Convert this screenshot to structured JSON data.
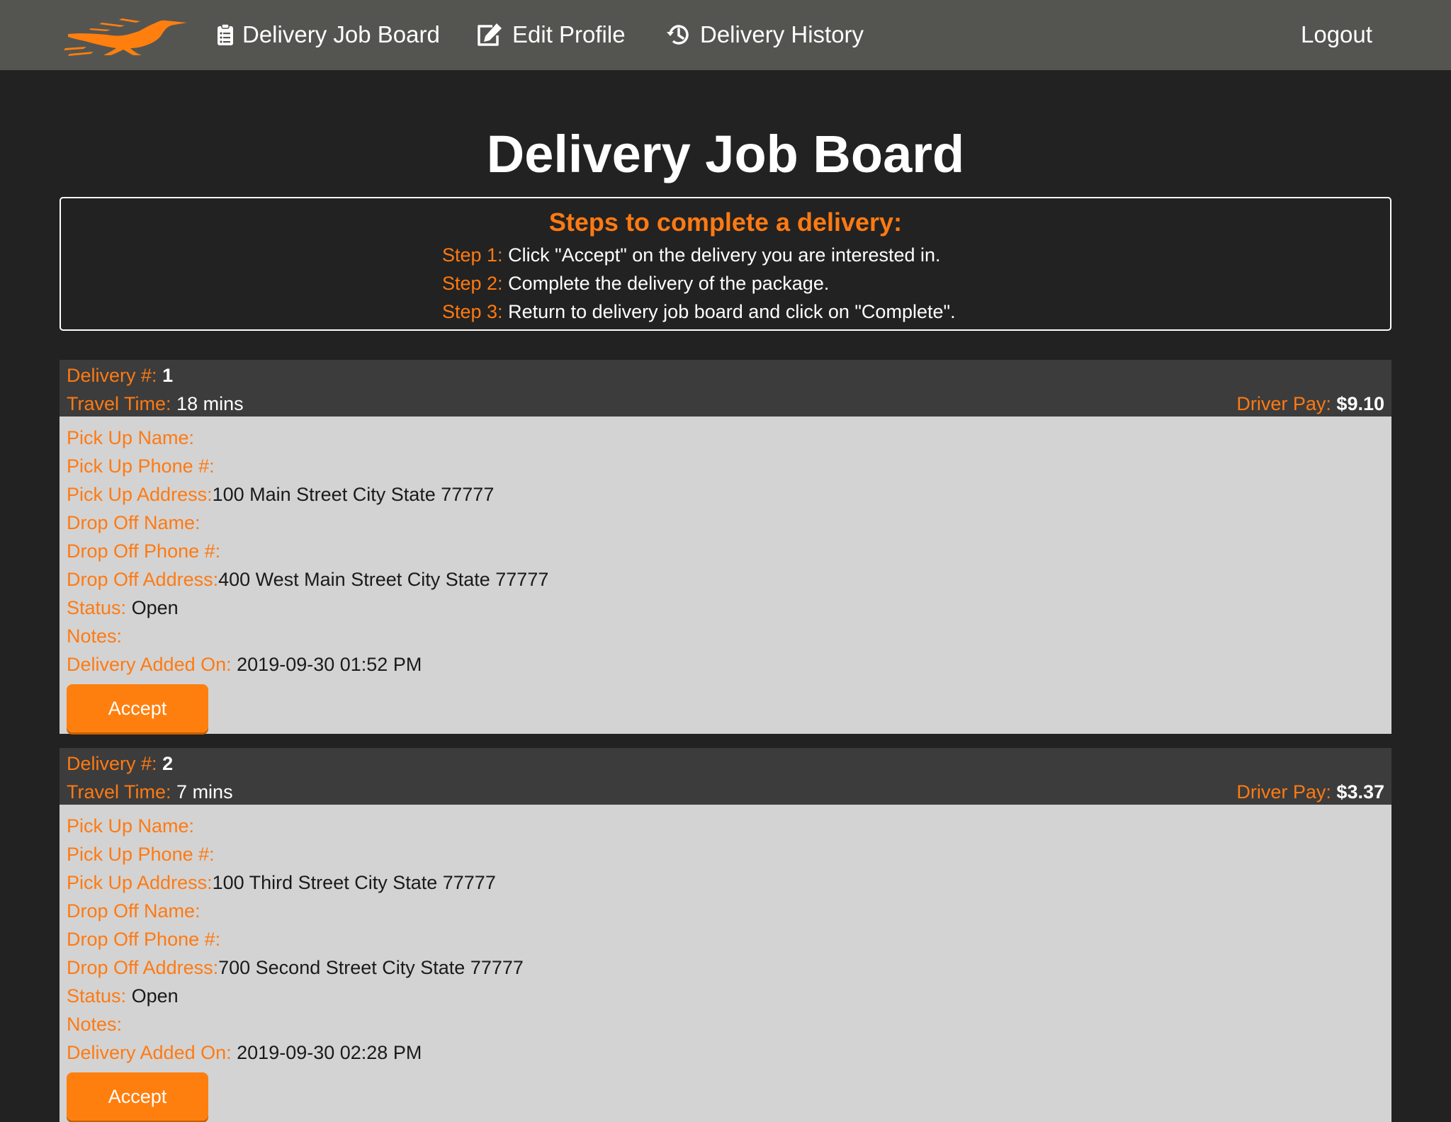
{
  "nav": {
    "job_board_label": "Delivery Job Board",
    "edit_profile_label": "Edit Profile",
    "history_label": "Delivery History",
    "logout_label": "Logout"
  },
  "page_title": "Delivery Job Board",
  "steps": {
    "heading": "Steps to complete a delivery:",
    "items": [
      {
        "label": "Step 1:",
        "text": "Click \"Accept\" on the delivery you are interested in."
      },
      {
        "label": "Step 2:",
        "text": "Complete the delivery of the package."
      },
      {
        "label": "Step 3:",
        "text": "Return to delivery job board and click on \"Complete\"."
      }
    ]
  },
  "labels": {
    "delivery_num": "Delivery #:",
    "travel_time": "Travel Time:",
    "driver_pay": "Driver Pay:",
    "pickup_name": "Pick Up Name:",
    "pickup_phone": "Pick Up Phone #:",
    "pickup_address": "Pick Up Address:",
    "dropoff_name": "Drop Off Name:",
    "dropoff_phone": "Drop Off Phone #:",
    "dropoff_address": "Drop Off Address:",
    "status": "Status:",
    "notes": "Notes:",
    "added_on": "Delivery Added On:",
    "accept": "Accept"
  },
  "deliveries": [
    {
      "number": "1",
      "travel_time": "18 mins",
      "driver_pay": "$9.10",
      "pickup_name": "",
      "pickup_phone": "",
      "pickup_address": "100 Main Street City State 77777",
      "dropoff_name": "",
      "dropoff_phone": "",
      "dropoff_address": "400 West Main Street City State 77777",
      "status": "Open",
      "notes": "",
      "added_on": "2019-09-30 01:52 PM"
    },
    {
      "number": "2",
      "travel_time": "7 mins",
      "driver_pay": "$3.37",
      "pickup_name": "",
      "pickup_phone": "",
      "pickup_address": "100 Third Street City State 77777",
      "dropoff_name": "",
      "dropoff_phone": "",
      "dropoff_address": "700 Second Street City State 77777",
      "status": "Open",
      "notes": "",
      "added_on": "2019-09-30 02:28 PM"
    }
  ],
  "colors": {
    "accent": "#ff7a12",
    "navbar": "#545551",
    "background": "#222222",
    "card_header": "#3c3c3c",
    "card_body": "#d3d3d3"
  },
  "icons": {
    "logo": "roadrunner-logo",
    "job_board": "clipboard-list-icon",
    "edit_profile": "edit-icon",
    "history": "history-icon"
  }
}
